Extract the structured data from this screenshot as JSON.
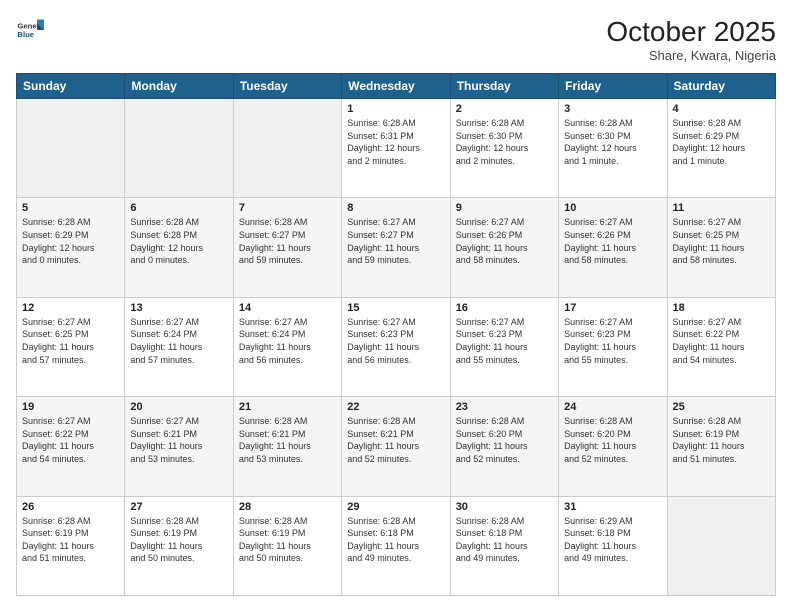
{
  "header": {
    "logo_general": "General",
    "logo_blue": "Blue",
    "month": "October 2025",
    "location": "Share, Kwara, Nigeria"
  },
  "weekdays": [
    "Sunday",
    "Monday",
    "Tuesday",
    "Wednesday",
    "Thursday",
    "Friday",
    "Saturday"
  ],
  "rows": [
    [
      {
        "day": "",
        "info": ""
      },
      {
        "day": "",
        "info": ""
      },
      {
        "day": "",
        "info": ""
      },
      {
        "day": "1",
        "info": "Sunrise: 6:28 AM\nSunset: 6:31 PM\nDaylight: 12 hours\nand 2 minutes."
      },
      {
        "day": "2",
        "info": "Sunrise: 6:28 AM\nSunset: 6:30 PM\nDaylight: 12 hours\nand 2 minutes."
      },
      {
        "day": "3",
        "info": "Sunrise: 6:28 AM\nSunset: 6:30 PM\nDaylight: 12 hours\nand 1 minute."
      },
      {
        "day": "4",
        "info": "Sunrise: 6:28 AM\nSunset: 6:29 PM\nDaylight: 12 hours\nand 1 minute."
      }
    ],
    [
      {
        "day": "5",
        "info": "Sunrise: 6:28 AM\nSunset: 6:29 PM\nDaylight: 12 hours\nand 0 minutes."
      },
      {
        "day": "6",
        "info": "Sunrise: 6:28 AM\nSunset: 6:28 PM\nDaylight: 12 hours\nand 0 minutes."
      },
      {
        "day": "7",
        "info": "Sunrise: 6:28 AM\nSunset: 6:27 PM\nDaylight: 11 hours\nand 59 minutes."
      },
      {
        "day": "8",
        "info": "Sunrise: 6:27 AM\nSunset: 6:27 PM\nDaylight: 11 hours\nand 59 minutes."
      },
      {
        "day": "9",
        "info": "Sunrise: 6:27 AM\nSunset: 6:26 PM\nDaylight: 11 hours\nand 58 minutes."
      },
      {
        "day": "10",
        "info": "Sunrise: 6:27 AM\nSunset: 6:26 PM\nDaylight: 11 hours\nand 58 minutes."
      },
      {
        "day": "11",
        "info": "Sunrise: 6:27 AM\nSunset: 6:25 PM\nDaylight: 11 hours\nand 58 minutes."
      }
    ],
    [
      {
        "day": "12",
        "info": "Sunrise: 6:27 AM\nSunset: 6:25 PM\nDaylight: 11 hours\nand 57 minutes."
      },
      {
        "day": "13",
        "info": "Sunrise: 6:27 AM\nSunset: 6:24 PM\nDaylight: 11 hours\nand 57 minutes."
      },
      {
        "day": "14",
        "info": "Sunrise: 6:27 AM\nSunset: 6:24 PM\nDaylight: 11 hours\nand 56 minutes."
      },
      {
        "day": "15",
        "info": "Sunrise: 6:27 AM\nSunset: 6:23 PM\nDaylight: 11 hours\nand 56 minutes."
      },
      {
        "day": "16",
        "info": "Sunrise: 6:27 AM\nSunset: 6:23 PM\nDaylight: 11 hours\nand 55 minutes."
      },
      {
        "day": "17",
        "info": "Sunrise: 6:27 AM\nSunset: 6:23 PM\nDaylight: 11 hours\nand 55 minutes."
      },
      {
        "day": "18",
        "info": "Sunrise: 6:27 AM\nSunset: 6:22 PM\nDaylight: 11 hours\nand 54 minutes."
      }
    ],
    [
      {
        "day": "19",
        "info": "Sunrise: 6:27 AM\nSunset: 6:22 PM\nDaylight: 11 hours\nand 54 minutes."
      },
      {
        "day": "20",
        "info": "Sunrise: 6:27 AM\nSunset: 6:21 PM\nDaylight: 11 hours\nand 53 minutes."
      },
      {
        "day": "21",
        "info": "Sunrise: 6:28 AM\nSunset: 6:21 PM\nDaylight: 11 hours\nand 53 minutes."
      },
      {
        "day": "22",
        "info": "Sunrise: 6:28 AM\nSunset: 6:21 PM\nDaylight: 11 hours\nand 52 minutes."
      },
      {
        "day": "23",
        "info": "Sunrise: 6:28 AM\nSunset: 6:20 PM\nDaylight: 11 hours\nand 52 minutes."
      },
      {
        "day": "24",
        "info": "Sunrise: 6:28 AM\nSunset: 6:20 PM\nDaylight: 11 hours\nand 52 minutes."
      },
      {
        "day": "25",
        "info": "Sunrise: 6:28 AM\nSunset: 6:19 PM\nDaylight: 11 hours\nand 51 minutes."
      }
    ],
    [
      {
        "day": "26",
        "info": "Sunrise: 6:28 AM\nSunset: 6:19 PM\nDaylight: 11 hours\nand 51 minutes."
      },
      {
        "day": "27",
        "info": "Sunrise: 6:28 AM\nSunset: 6:19 PM\nDaylight: 11 hours\nand 50 minutes."
      },
      {
        "day": "28",
        "info": "Sunrise: 6:28 AM\nSunset: 6:19 PM\nDaylight: 11 hours\nand 50 minutes."
      },
      {
        "day": "29",
        "info": "Sunrise: 6:28 AM\nSunset: 6:18 PM\nDaylight: 11 hours\nand 49 minutes."
      },
      {
        "day": "30",
        "info": "Sunrise: 6:28 AM\nSunset: 6:18 PM\nDaylight: 11 hours\nand 49 minutes."
      },
      {
        "day": "31",
        "info": "Sunrise: 6:29 AM\nSunset: 6:18 PM\nDaylight: 11 hours\nand 49 minutes."
      },
      {
        "day": "",
        "info": ""
      }
    ]
  ]
}
